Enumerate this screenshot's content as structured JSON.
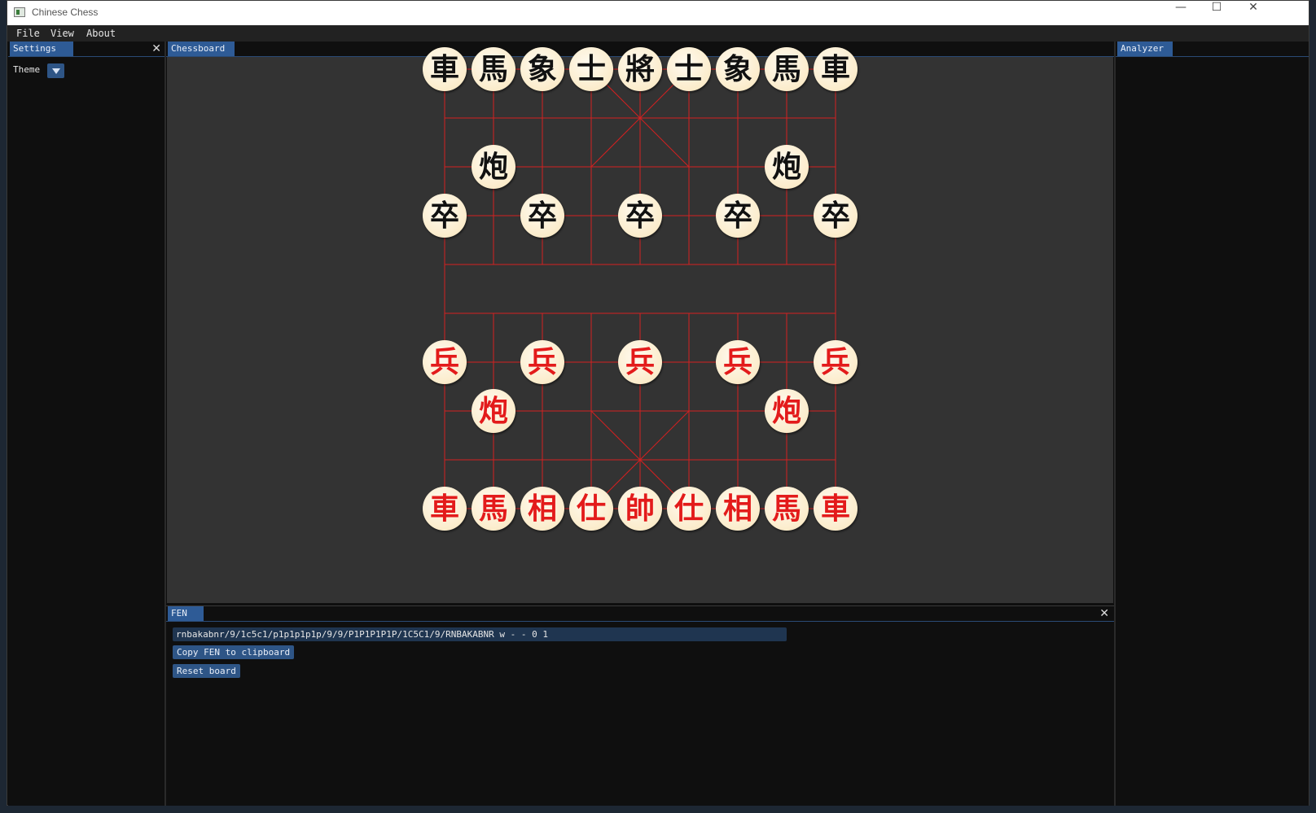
{
  "window": {
    "title": "Chinese Chess",
    "controls": {
      "minimize": "—",
      "maximize": "☐",
      "close": "✕"
    }
  },
  "menu": [
    "File",
    "View",
    "About"
  ],
  "settings": {
    "tab": "Settings",
    "close": "✕",
    "theme_label": "Theme"
  },
  "chessboard": {
    "tab": "Chessboard",
    "line_color": "#d42020",
    "background": "#333333",
    "board_rows": [
      "車馬象士將士象馬車",
      ".........",
      ".炮.....炮.",
      "卒.卒.卒.卒.卒",
      ".........",
      ".........",
      "兵.兵.兵.兵.兵",
      ".炮.....炮.",
      ".........",
      "車馬相仕帥仕相馬車"
    ],
    "black_pieces": [
      {
        "c": "車",
        "f": 0,
        "r": 0
      },
      {
        "c": "馬",
        "f": 1,
        "r": 0
      },
      {
        "c": "象",
        "f": 2,
        "r": 0
      },
      {
        "c": "士",
        "f": 3,
        "r": 0
      },
      {
        "c": "將",
        "f": 4,
        "r": 0
      },
      {
        "c": "士",
        "f": 5,
        "r": 0
      },
      {
        "c": "象",
        "f": 6,
        "r": 0
      },
      {
        "c": "馬",
        "f": 7,
        "r": 0
      },
      {
        "c": "車",
        "f": 8,
        "r": 0
      },
      {
        "c": "炮",
        "f": 1,
        "r": 2
      },
      {
        "c": "炮",
        "f": 7,
        "r": 2
      },
      {
        "c": "卒",
        "f": 0,
        "r": 3
      },
      {
        "c": "卒",
        "f": 2,
        "r": 3
      },
      {
        "c": "卒",
        "f": 4,
        "r": 3
      },
      {
        "c": "卒",
        "f": 6,
        "r": 3
      },
      {
        "c": "卒",
        "f": 8,
        "r": 3
      }
    ],
    "red_pieces": [
      {
        "c": "兵",
        "f": 0,
        "r": 6
      },
      {
        "c": "兵",
        "f": 2,
        "r": 6
      },
      {
        "c": "兵",
        "f": 4,
        "r": 6
      },
      {
        "c": "兵",
        "f": 6,
        "r": 6
      },
      {
        "c": "兵",
        "f": 8,
        "r": 6
      },
      {
        "c": "炮",
        "f": 1,
        "r": 7
      },
      {
        "c": "炮",
        "f": 7,
        "r": 7
      },
      {
        "c": "車",
        "f": 0,
        "r": 9
      },
      {
        "c": "馬",
        "f": 1,
        "r": 9
      },
      {
        "c": "相",
        "f": 2,
        "r": 9
      },
      {
        "c": "仕",
        "f": 3,
        "r": 9
      },
      {
        "c": "帥",
        "f": 4,
        "r": 9
      },
      {
        "c": "仕",
        "f": 5,
        "r": 9
      },
      {
        "c": "相",
        "f": 6,
        "r": 9
      },
      {
        "c": "馬",
        "f": 7,
        "r": 9
      },
      {
        "c": "車",
        "f": 8,
        "r": 9
      }
    ]
  },
  "analyzer": {
    "tab": "Analyzer"
  },
  "fen_panel": {
    "tab": "FEN",
    "close": "✕",
    "fen_value": "rnbakabnr/9/1c5c1/p1p1p1p1p/9/9/P1P1P1P1P/1C5C1/9/RNBAKABNR w - - 0 1",
    "copy_button": "Copy FEN to clipboard",
    "reset_button": "Reset board"
  }
}
